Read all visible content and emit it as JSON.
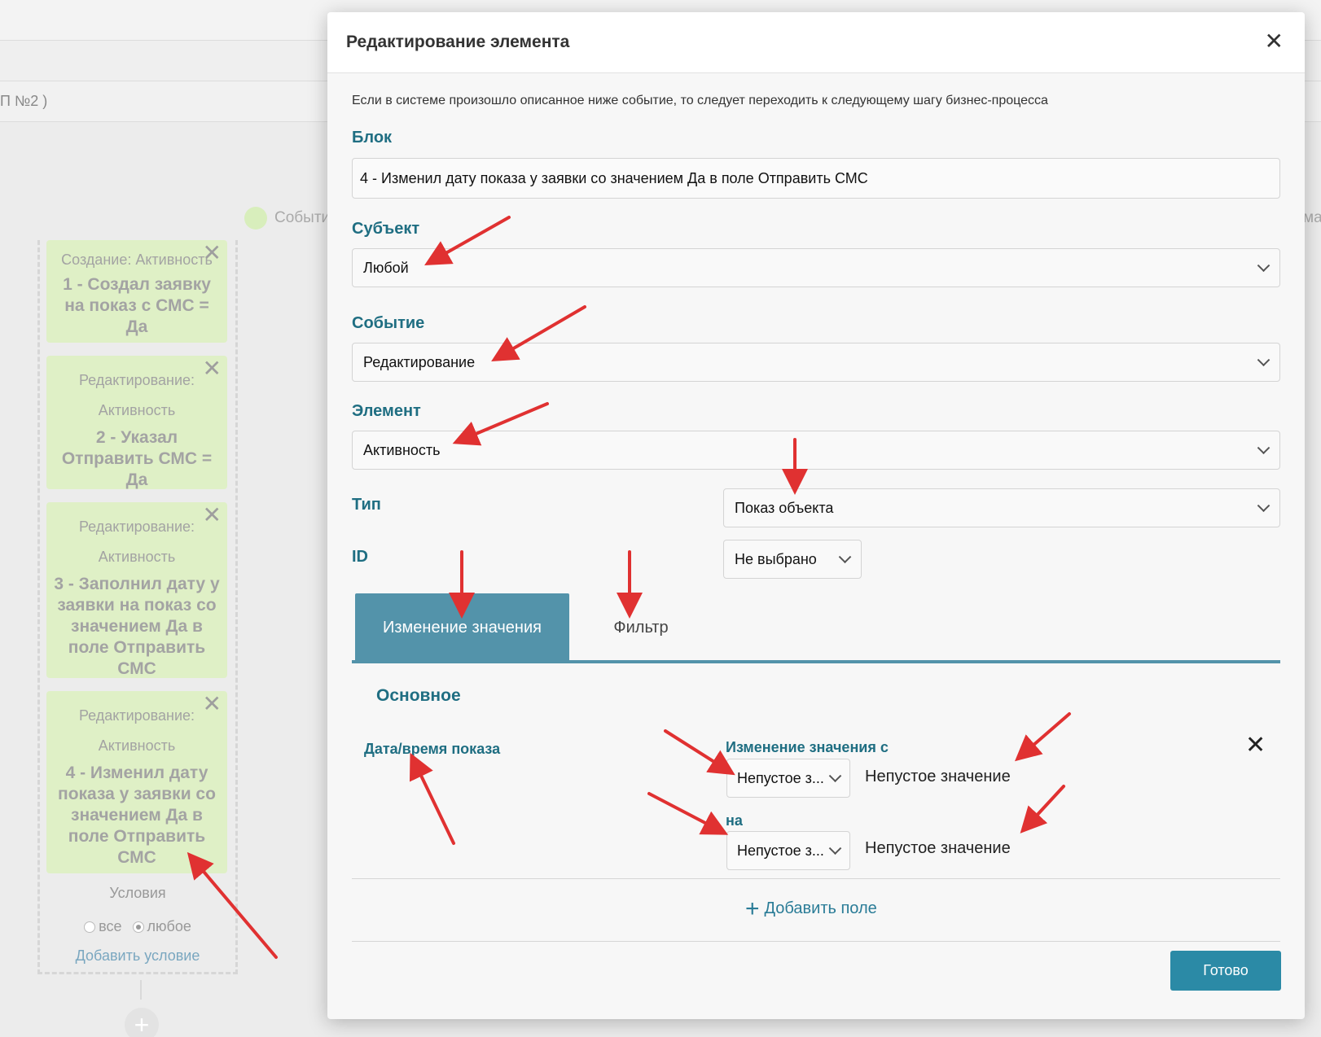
{
  "background": {
    "crumb_text": "П №2 )",
    "event_label": "Событи",
    "right_cut_label": "ма",
    "cards": [
      {
        "type": "Создание: Активность",
        "title": "1 - Создал заявку на показ с СМС = Да"
      },
      {
        "type": "Редактирование: Активность",
        "title": "2 - Указал Отправить СМС = Да"
      },
      {
        "type": "Редактирование: Активность",
        "title": "3 - Заполнил дату у заявки на показ со значением Да в поле Отправить СМС"
      },
      {
        "type": "Редактирование: Активность",
        "title": "4 - Изменил дату показа у заявки со значением Да в поле Отправить СМС"
      }
    ],
    "conditions_label": "Условия",
    "radio_all": "все",
    "radio_any": "любое",
    "add_condition": "Добавить условие"
  },
  "modal": {
    "title": "Редактирование элемента",
    "description": "Если в системе произошло описанное ниже событие, то следует переходить к следующему шагу бизнес-процесса",
    "block_label": "Блок",
    "block_value": "4 - Изменил дату показа у заявки со значением Да в поле Отправить СМС",
    "subject_label": "Субъект",
    "subject_value": "Любой",
    "event_label": "Событие",
    "event_value": "Редактирование",
    "element_label": "Элемент",
    "element_value": "Активность",
    "type_label": "Тип",
    "type_value": "Показ объекта",
    "id_label": "ID",
    "id_value": "Не выбрано",
    "tabs": [
      {
        "label": "Изменение значения",
        "active": true
      },
      {
        "label": "Фильтр",
        "active": false
      }
    ],
    "section_title": "Основное",
    "field_name": "Дата/время показа",
    "change_from_label": "Изменение значения с",
    "from_select": "Непустое з...",
    "from_text": "Непустое значение",
    "to_label": "на",
    "to_select": "Непустое з...",
    "to_text": "Непустое значение",
    "add_field": "Добавить поле",
    "done_button": "Готово"
  },
  "colors": {
    "accent": "#1f6e82",
    "tab_active": "#5393aa",
    "done_button": "#2b8aa6",
    "annotation_arrow": "#e03131",
    "card_bg": "#dff0c6"
  }
}
